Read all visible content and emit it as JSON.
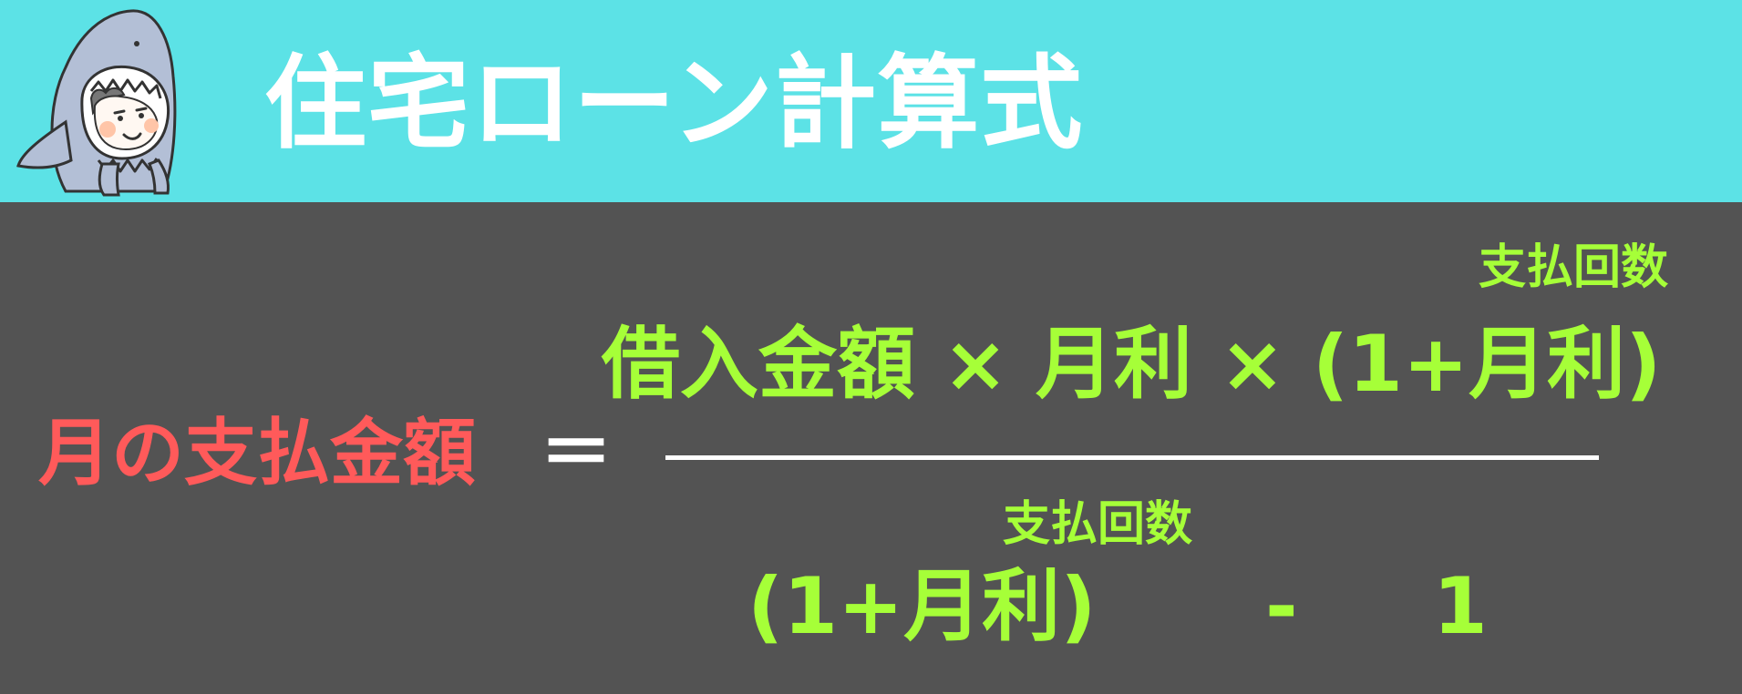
{
  "header": {
    "title": "住宅ローン計算式",
    "mascot_icon": "shark-costume-character-icon",
    "background_color": "#5ce2e6"
  },
  "formula": {
    "lhs": "月の支払金額",
    "equals": "＝",
    "numerator": "借入金額 × 月利 × (1+月利)",
    "numerator_exponent": "支払回数",
    "denominator_base": "(1+月利)",
    "denominator_exponent": "支払回数",
    "denominator_minus": "-",
    "denominator_one": "1",
    "colors": {
      "lhs": "#ff5a5a",
      "terms": "#a6ff38",
      "background": "#535353"
    }
  }
}
